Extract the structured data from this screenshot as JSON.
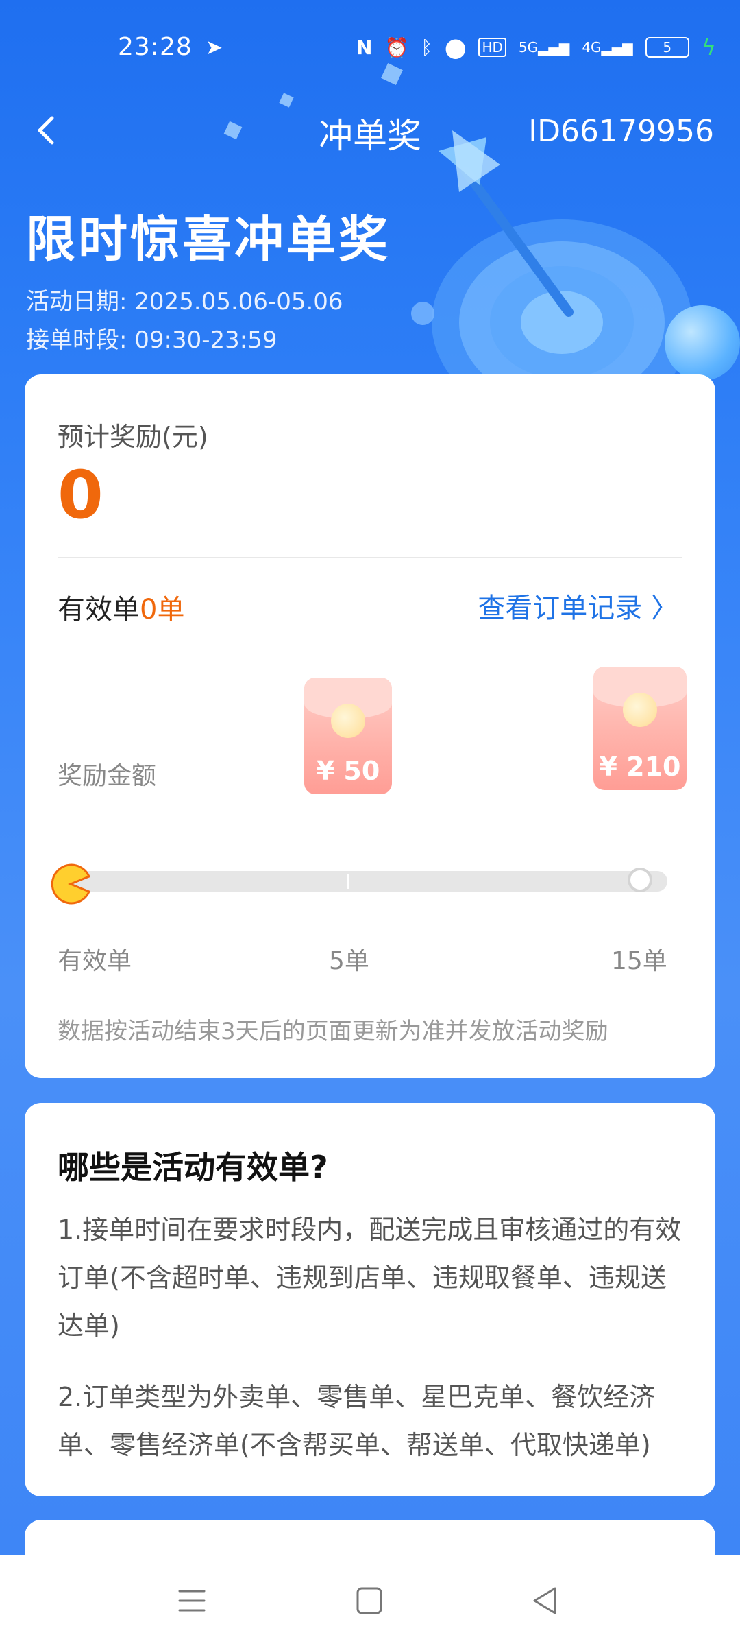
{
  "status_bar": {
    "time": "23:28",
    "battery": "5",
    "icons": [
      "send-icon",
      "nfc-icon",
      "alarm-icon",
      "bluetooth-icon",
      "location-icon",
      "hd-icon",
      "signal-5g-icon",
      "signal-4g-icon",
      "battery-icon",
      "charging-icon"
    ],
    "hd_label": "HD",
    "net1": "5G",
    "net2": "4G"
  },
  "header": {
    "title": "冲单奖",
    "id_text": "ID66179956"
  },
  "hero": {
    "title": "限时惊喜冲单奖",
    "date_line": "活动日期: 2025.05.06-05.06",
    "time_line": "接单时段: 09:30-23:59"
  },
  "reward_card": {
    "estimate_label": "预计奖励(元)",
    "estimate_value": "0",
    "valid_prefix": "有效单",
    "valid_count": "0单",
    "orders_link": "查看订单记录 〉",
    "reward_label": "奖励金额",
    "tiers": [
      {
        "amount": "¥ 50",
        "threshold": "5单"
      },
      {
        "amount": "¥ 210",
        "threshold": "15单"
      }
    ],
    "progress_start_label": "有效单",
    "progress_fraction": 0,
    "note": "数据按活动结束3天后的页面更新为准并发放活动奖励"
  },
  "rules_card": {
    "title": "哪些是活动有效单?",
    "rule1": "1.接单时间在要求时段内，配送完成且审核通过的有效订单(不含超时单、违规到店单、违规取餐单、违规送达单)",
    "rule2": "2.订单类型为外卖单、零售单、星巴克单、餐饮经济单、零售经济单(不含帮买单、帮送单、代取快递单)"
  },
  "colors": {
    "accent_orange": "#f0680c",
    "link_blue": "#1f73e6",
    "background_blue": "#2a7bf5"
  }
}
